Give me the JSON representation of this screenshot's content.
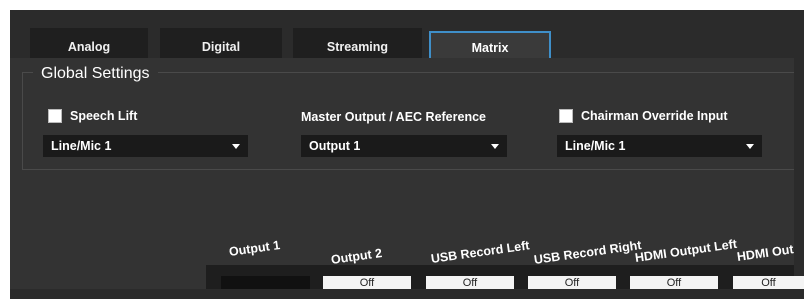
{
  "tabs": [
    {
      "label": "Analog"
    },
    {
      "label": "Digital"
    },
    {
      "label": "Streaming"
    },
    {
      "label": "Matrix",
      "active": true
    }
  ],
  "global_settings": {
    "title": "Global Settings",
    "speech_lift": {
      "label": "Speech Lift",
      "checked": false,
      "select_value": "Line/Mic 1"
    },
    "master_output": {
      "label": "Master Output / AEC Reference",
      "select_value": "Output 1"
    },
    "chairman_override": {
      "label": "Chairman Override Input",
      "checked": false,
      "select_value": "Line/Mic 1"
    }
  },
  "matrix": {
    "columns": [
      "Output 1",
      "Output 2",
      "USB Record Left",
      "USB Record Right",
      "HDMI Output Left",
      "HDMI Out"
    ],
    "first_row_cells": [
      "",
      "Off",
      "Off",
      "Off",
      "Off",
      "Off"
    ]
  },
  "colors": {
    "accent": "#3f8fc9",
    "background": "#333333"
  }
}
